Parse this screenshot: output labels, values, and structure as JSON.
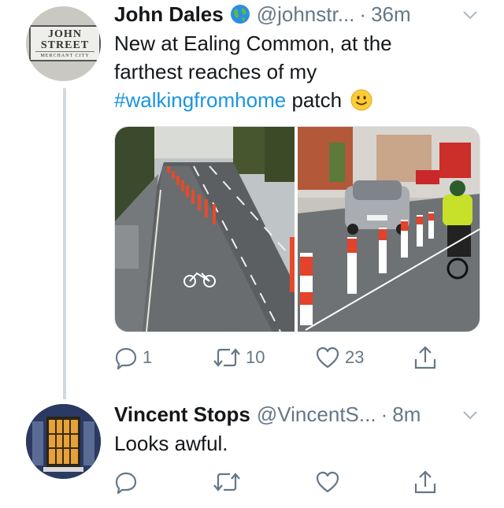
{
  "tweets": [
    {
      "author_name": "John Dales",
      "author_badge": "globe-emoji",
      "handle": "@johnstr...",
      "separator": "·",
      "time": "36m",
      "avatar": {
        "line1": "JOHN",
        "line2": "STREET",
        "line3": "MERCHANT CITY"
      },
      "text_line1": "New at Ealing Common, at the",
      "text_line2": "farthest reaches of my",
      "hashtag": "#walkingfromhome",
      "text_after_hashtag": "patch",
      "emoji": "slightly-smiling-face",
      "media_images": [
        "cycle-lane-with-wands-photo",
        "car-and-cyclist-photo"
      ],
      "actions": {
        "replies": "1",
        "retweets": "10",
        "likes": "23"
      }
    },
    {
      "author_name": "Vincent Stops",
      "handle": "@VincentS...",
      "separator": "·",
      "time": "8m",
      "text": "Looks awful.",
      "actions": {
        "replies": "",
        "retweets": "",
        "likes": ""
      }
    }
  ],
  "colors": {
    "hashtag": "#1b95e0",
    "secondary_text": "#657786",
    "thread_line": "#cfd9de"
  }
}
